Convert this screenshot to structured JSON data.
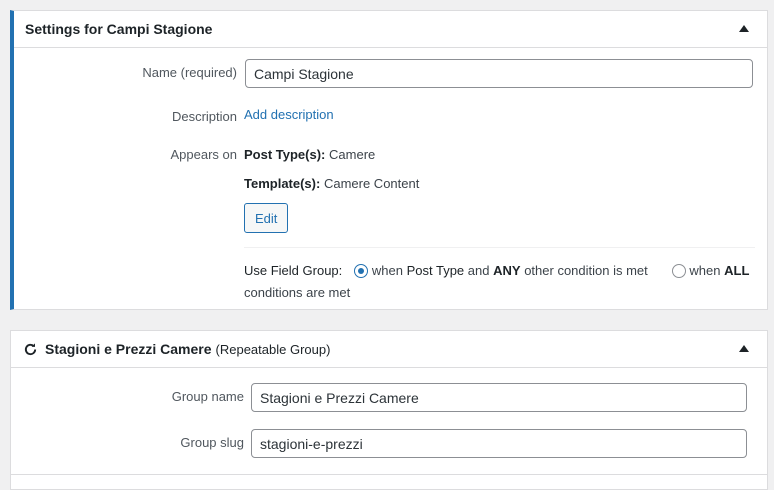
{
  "settings_box": {
    "title": "Settings for Campi Stagione",
    "name_label": "Name (required)",
    "name_value": "Campi Stagione",
    "description_label": "Description",
    "add_description_link": "Add description",
    "appears_on_label": "Appears on",
    "post_types_label": "Post Type(s):",
    "post_types_value": "Camere",
    "templates_label": "Template(s):",
    "templates_value": "Camere Content",
    "edit_button": "Edit",
    "use_field_group_label": "Use Field Group:",
    "option_any": {
      "prefix": "when",
      "post_type": "Post Type",
      "and": "and",
      "any": "ANY",
      "suffix": "other condition is met",
      "checked": true
    },
    "option_all": {
      "prefix": "when",
      "all": "ALL",
      "suffix": "conditions are met",
      "checked": false
    }
  },
  "group_box": {
    "title": "Stagioni e Prezzi Camere",
    "subtitle": "(Repeatable Group)",
    "icon": "refresh-icon",
    "group_name_label": "Group name",
    "group_name_value": "Stagioni e Prezzi Camere",
    "group_slug_label": "Group slug",
    "group_slug_value": "stagioni-e-prezzi"
  },
  "colors": {
    "accent": "#2271b1",
    "background": "#f0f0f1",
    "border": "#dcdcde"
  }
}
